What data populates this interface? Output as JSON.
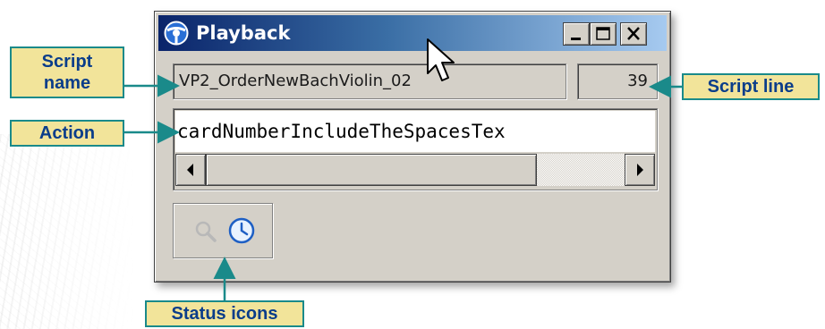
{
  "window": {
    "title": "Playback",
    "buttons": {
      "minimize": "minimize-button",
      "maximize": "maximize-button",
      "close": "close-button"
    }
  },
  "fields": {
    "script_name": "VP2_OrderNewBachViolin_02",
    "script_line": "39",
    "action": "cardNumberIncludeTheSpacesTex"
  },
  "status_icons": [
    "magnifier-icon",
    "clock-icon"
  ],
  "callouts": {
    "script_name": "Script\nname",
    "script_line": "Script line",
    "action": "Action",
    "status_icons": "Status icons"
  },
  "colors": {
    "title_gradient_start": "#0a246a",
    "title_gradient_end": "#a6caf0",
    "window_face": "#d4d0c8",
    "callout_fill": "#f2e49a",
    "callout_border": "#1a8a8a",
    "callout_text": "#0a3d8a"
  }
}
